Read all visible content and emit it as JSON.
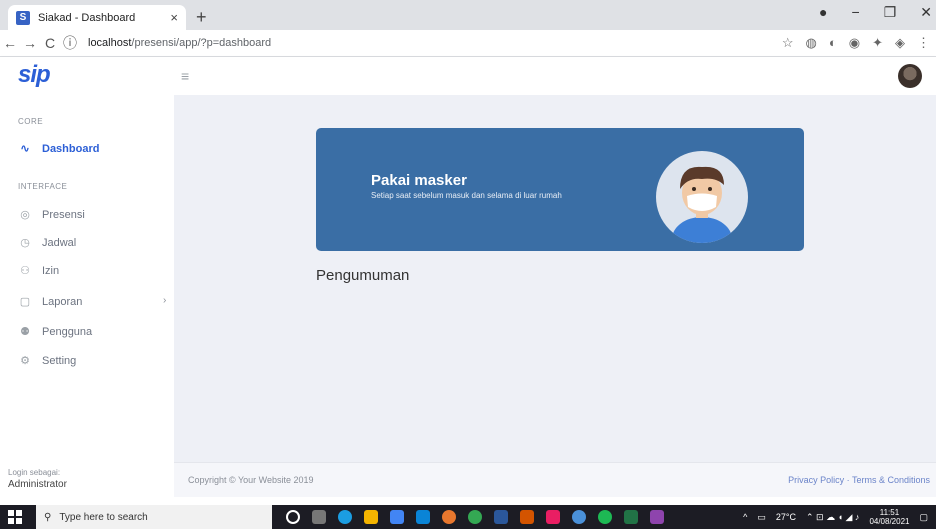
{
  "browser": {
    "tab_title": "Siakad - Dashboard",
    "favicon_letter": "S",
    "url_host": "localhost",
    "url_path": "/presensi/app/?p=dashboard"
  },
  "app": {
    "logo": "sip"
  },
  "sidebar": {
    "core_heading": "CORE",
    "interface_heading": "INTERFACE",
    "items": [
      {
        "label": "Dashboard",
        "icon": "activity-icon",
        "active": true
      },
      {
        "label": "Presensi",
        "icon": "fingerprint-icon"
      },
      {
        "label": "Jadwal",
        "icon": "clock-icon"
      },
      {
        "label": "Izin",
        "icon": "user-plus-icon"
      },
      {
        "label": "Laporan",
        "icon": "file-icon",
        "has_submenu": true
      },
      {
        "label": "Pengguna",
        "icon": "users-icon"
      },
      {
        "label": "Setting",
        "icon": "gear-icon"
      }
    ],
    "login_as_label": "Login sebagai:",
    "login_role": "Administrator"
  },
  "banner": {
    "title": "Pakai masker",
    "subtitle": "Setiap saat sebelum masuk dan selama di luar rumah",
    "bg_color": "#3a6ea5"
  },
  "main": {
    "section_title": "Pengumuman"
  },
  "footer": {
    "copyright": "Copyright © Your Website 2019",
    "links": "Privacy Policy · Terms & Conditions"
  },
  "taskbar": {
    "search_placeholder": "Type here to search",
    "temperature": "27°C",
    "time": "11:51",
    "date": "04/08/2021"
  }
}
